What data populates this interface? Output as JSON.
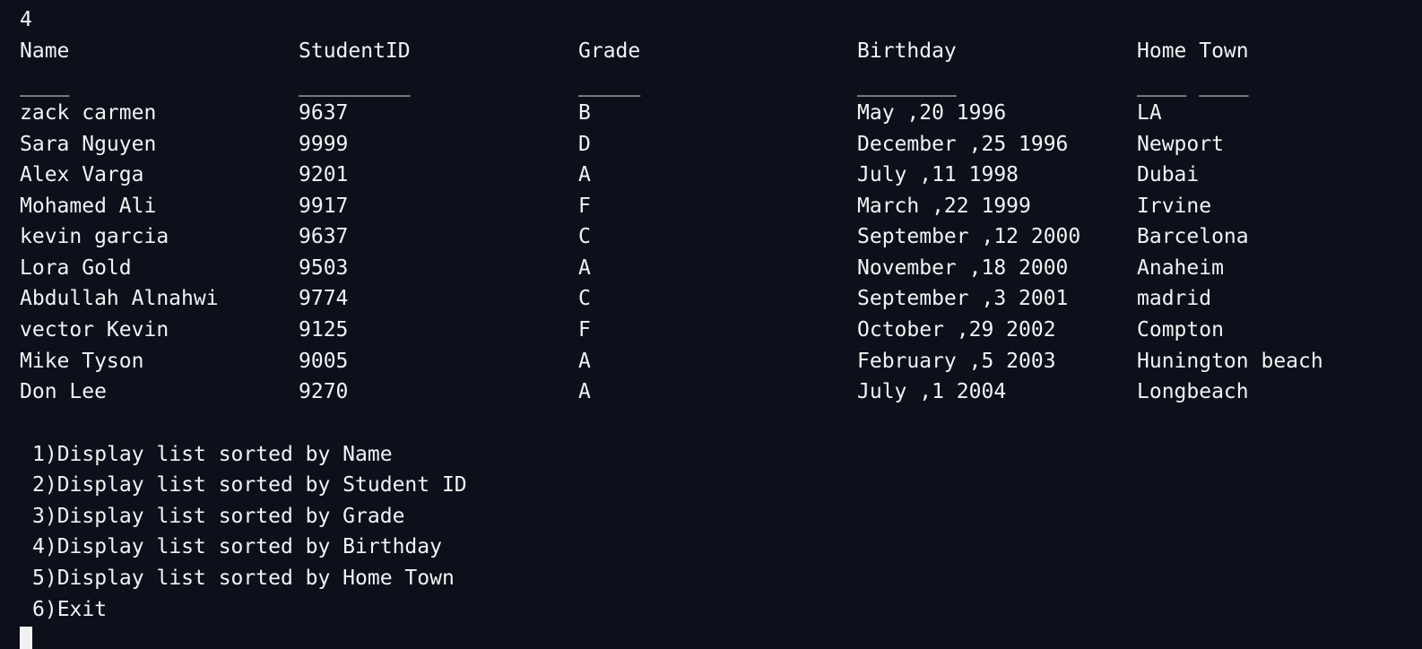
{
  "terminal": {
    "partial_top": "",
    "input_echo": "4",
    "headers": {
      "name": "Name",
      "student_id": "StudentID",
      "grade": "Grade",
      "birthday": "Birthday",
      "home_town": "Home Town"
    },
    "underlines": {
      "name": "____",
      "student_id": "_________",
      "grade": "_____",
      "birthday": "________",
      "home_town": "____ ____"
    },
    "rows": [
      {
        "name": "zack carmen",
        "id": "9637",
        "grade": "B",
        "birthday": "May ,20 1996",
        "town": "LA"
      },
      {
        "name": "Sara Nguyen",
        "id": "9999",
        "grade": "D",
        "birthday": "December ,25 1996",
        "town": "Newport"
      },
      {
        "name": "Alex Varga",
        "id": "9201",
        "grade": "A",
        "birthday": "July ,11 1998",
        "town": "Dubai"
      },
      {
        "name": "Mohamed Ali",
        "id": "9917",
        "grade": "F",
        "birthday": "March ,22 1999",
        "town": "Irvine"
      },
      {
        "name": "kevin garcia",
        "id": "9637",
        "grade": "C",
        "birthday": "September ,12 2000",
        "town": "Barcelona"
      },
      {
        "name": "Lora Gold",
        "id": "9503",
        "grade": "A",
        "birthday": "November ,18 2000",
        "town": "Anaheim"
      },
      {
        "name": "Abdullah Alnahwi",
        "id": "9774",
        "grade": "C",
        "birthday": "September ,3 2001",
        "town": "madrid"
      },
      {
        "name": "vector Kevin",
        "id": "9125",
        "grade": "F",
        "birthday": "October ,29 2002",
        "town": "Compton"
      },
      {
        "name": "Mike Tyson",
        "id": "9005",
        "grade": "A",
        "birthday": "February ,5 2003",
        "town": "Hunington beach"
      },
      {
        "name": "Don Lee",
        "id": "9270",
        "grade": "A",
        "birthday": "July ,1 2004",
        "town": "Longbeach"
      }
    ],
    "menu": [
      "1)Display list sorted by Name",
      "2)Display list sorted by Student ID",
      "3)Display list sorted by Grade",
      "4)Display list sorted by Birthday",
      "5)Display list sorted by Home Town",
      "6)Exit"
    ],
    "colors": {
      "background": "#0c101b",
      "foreground": "#f2f2f2"
    }
  }
}
